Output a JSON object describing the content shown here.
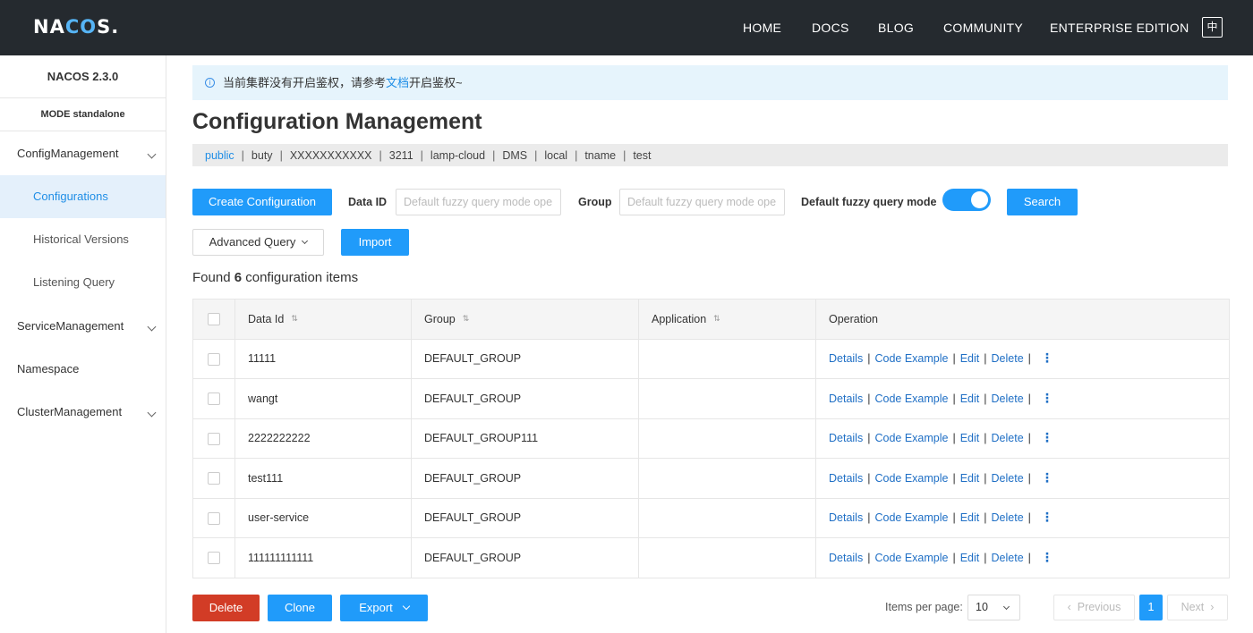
{
  "header": {
    "logo_pre": "NA",
    "logo_co": "CO",
    "logo_post": "S.",
    "nav": [
      "HOME",
      "DOCS",
      "BLOG",
      "COMMUNITY",
      "ENTERPRISE EDITION"
    ],
    "lang": "中"
  },
  "sidebar": {
    "version": "NACOS 2.3.0",
    "mode": "MODE standalone",
    "items": [
      {
        "label": "ConfigManagement"
      },
      {
        "label": "Configurations"
      },
      {
        "label": "Historical Versions"
      },
      {
        "label": "Listening Query"
      },
      {
        "label": "ServiceManagement"
      },
      {
        "label": "Namespace"
      },
      {
        "label": "ClusterManagement"
      }
    ]
  },
  "notice": {
    "pre": "当前集群没有开启鉴权，请参考",
    "link": "文档",
    "post": "开启鉴权~"
  },
  "title": "Configuration Management",
  "namespaces": [
    "public",
    "buty",
    "XXXXXXXXXXX",
    "3211",
    "lamp-cloud",
    "DMS",
    "local",
    "tname",
    "test"
  ],
  "toolbar": {
    "create": "Create Configuration",
    "data_id_label": "Data ID",
    "data_id_placeholder": "Default fuzzy query mode ope",
    "group_label": "Group",
    "group_placeholder": "Default fuzzy query mode ope",
    "fuzzy_label": "Default fuzzy query mode",
    "search": "Search",
    "advanced": "Advanced Query",
    "import": "Import"
  },
  "found": {
    "pre": "Found",
    "count": "6",
    "post": "configuration items"
  },
  "table": {
    "headers": [
      "Data Id",
      "Group",
      "Application",
      "Operation"
    ],
    "ops": [
      "Details",
      "Code Example",
      "Edit",
      "Delete"
    ],
    "rows": [
      {
        "data_id": "11111",
        "group": "DEFAULT_GROUP",
        "app": ""
      },
      {
        "data_id": "wangt",
        "group": "DEFAULT_GROUP",
        "app": ""
      },
      {
        "data_id": "2222222222",
        "group": "DEFAULT_GROUP111",
        "app": ""
      },
      {
        "data_id": "test111",
        "group": "DEFAULT_GROUP",
        "app": ""
      },
      {
        "data_id": "user-service",
        "group": "DEFAULT_GROUP",
        "app": ""
      },
      {
        "data_id": "111111111111",
        "group": "DEFAULT_GROUP",
        "app": ""
      }
    ]
  },
  "footer": {
    "delete": "Delete",
    "clone": "Clone",
    "export": "Export",
    "per_page_label": "Items per page:",
    "per_page_value": "10",
    "previous": "Previous",
    "page": "1",
    "next": "Next"
  },
  "colors": {
    "header_bg": "#252a2f",
    "primary": "#209bfa",
    "danger": "#d23c26",
    "link": "#1f6fc5"
  }
}
